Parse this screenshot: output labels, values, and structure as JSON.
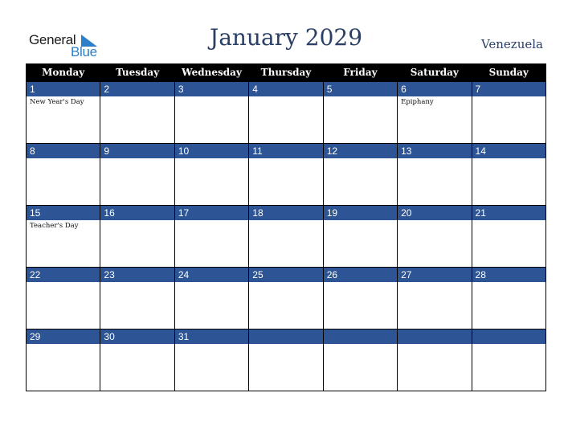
{
  "brand": {
    "line1": "General",
    "line2": "Blue",
    "accent_color": "#2f7fc8"
  },
  "header": {
    "title": "January 2029",
    "country": "Venezuela"
  },
  "colors": {
    "header_bg": "#000000",
    "day_band": "#2d5494",
    "title": "#2a3f66"
  },
  "weekdays": [
    "Monday",
    "Tuesday",
    "Wednesday",
    "Thursday",
    "Friday",
    "Saturday",
    "Sunday"
  ],
  "weeks": [
    [
      {
        "day": "1",
        "holiday": "New Year's Day"
      },
      {
        "day": "2",
        "holiday": ""
      },
      {
        "day": "3",
        "holiday": ""
      },
      {
        "day": "4",
        "holiday": ""
      },
      {
        "day": "5",
        "holiday": ""
      },
      {
        "day": "6",
        "holiday": "Epiphany"
      },
      {
        "day": "7",
        "holiday": ""
      }
    ],
    [
      {
        "day": "8",
        "holiday": ""
      },
      {
        "day": "9",
        "holiday": ""
      },
      {
        "day": "10",
        "holiday": ""
      },
      {
        "day": "11",
        "holiday": ""
      },
      {
        "day": "12",
        "holiday": ""
      },
      {
        "day": "13",
        "holiday": ""
      },
      {
        "day": "14",
        "holiday": ""
      }
    ],
    [
      {
        "day": "15",
        "holiday": "Teacher's Day"
      },
      {
        "day": "16",
        "holiday": ""
      },
      {
        "day": "17",
        "holiday": ""
      },
      {
        "day": "18",
        "holiday": ""
      },
      {
        "day": "19",
        "holiday": ""
      },
      {
        "day": "20",
        "holiday": ""
      },
      {
        "day": "21",
        "holiday": ""
      }
    ],
    [
      {
        "day": "22",
        "holiday": ""
      },
      {
        "day": "23",
        "holiday": ""
      },
      {
        "day": "24",
        "holiday": ""
      },
      {
        "day": "25",
        "holiday": ""
      },
      {
        "day": "26",
        "holiday": ""
      },
      {
        "day": "27",
        "holiday": ""
      },
      {
        "day": "28",
        "holiday": ""
      }
    ],
    [
      {
        "day": "29",
        "holiday": ""
      },
      {
        "day": "30",
        "holiday": ""
      },
      {
        "day": "31",
        "holiday": ""
      },
      {
        "day": "",
        "holiday": ""
      },
      {
        "day": "",
        "holiday": ""
      },
      {
        "day": "",
        "holiday": ""
      },
      {
        "day": "",
        "holiday": ""
      }
    ]
  ]
}
